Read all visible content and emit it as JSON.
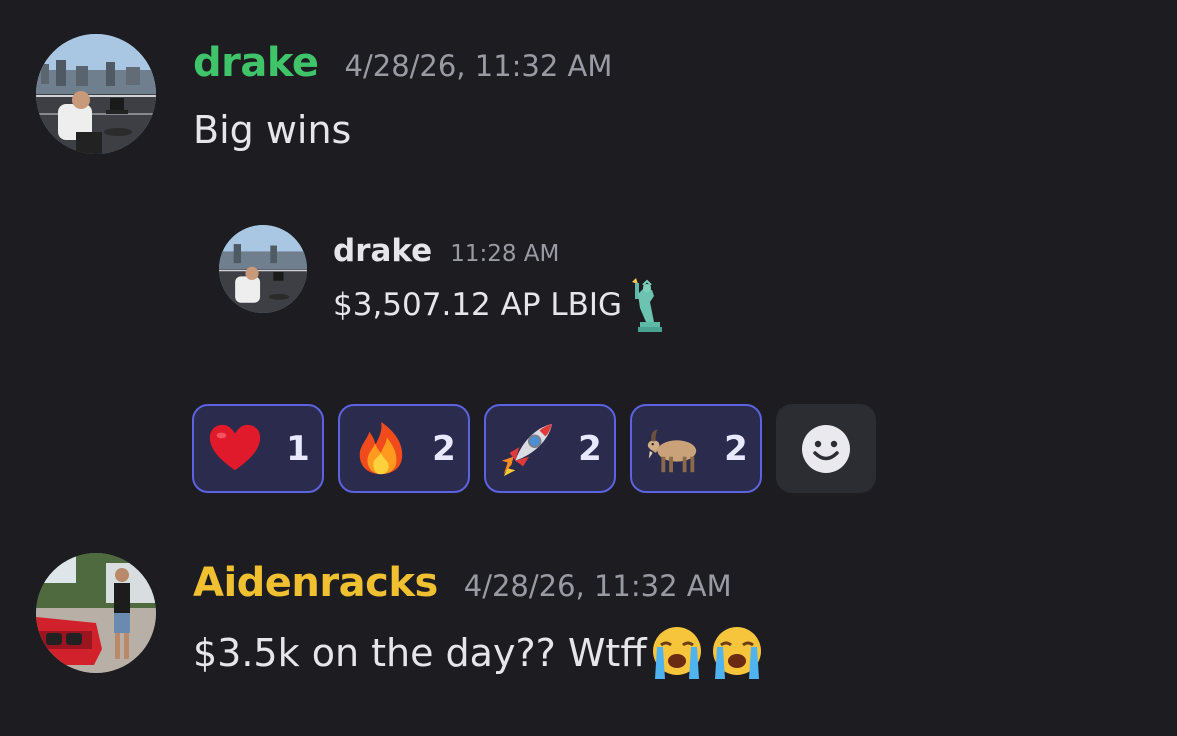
{
  "messages": [
    {
      "username": "drake",
      "username_color": "#3fc46a",
      "timestamp": "4/28/26, 11:32 AM",
      "text": "Big wins",
      "avatar": "rooftop-photo"
    },
    {
      "username": "Aidenracks",
      "username_color": "#f0c030",
      "timestamp": "4/28/26, 11:32 AM",
      "text": "$3.5k on the day?? Wtff",
      "avatar": "red-car-photo",
      "trailing_emoji": [
        "loudly-crying-face",
        "loudly-crying-face"
      ]
    }
  ],
  "forwarded": {
    "username": "drake",
    "timestamp": "11:28 AM",
    "text": "$3,507.12 AP LBIG",
    "trailing_emoji": "statue-of-liberty",
    "avatar": "rooftop-photo"
  },
  "reactions": [
    {
      "emoji": "red-heart",
      "count": "1"
    },
    {
      "emoji": "fire",
      "count": "2"
    },
    {
      "emoji": "rocket",
      "count": "2"
    },
    {
      "emoji": "goat",
      "count": "2"
    }
  ],
  "add_reaction": {
    "icon": "smiley-face-icon"
  },
  "colors": {
    "background": "#1c1c21",
    "reaction_border": "#5d63e0",
    "reaction_bg": "#2a2b4d"
  }
}
